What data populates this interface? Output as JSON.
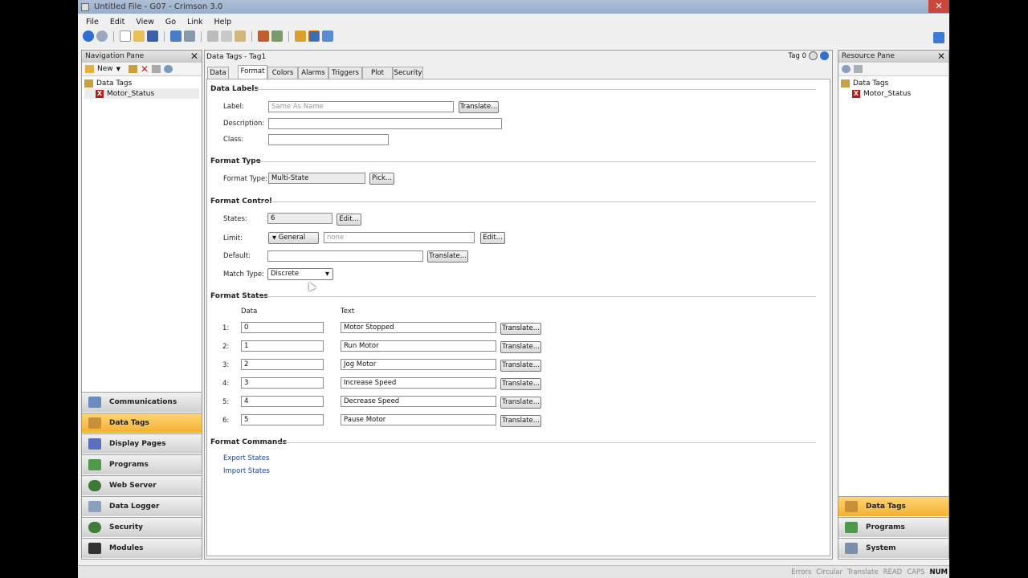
{
  "window": {
    "title": "Untitled File - G07 - Crimson 3.0"
  },
  "menu": [
    "File",
    "Edit",
    "View",
    "Go",
    "Link",
    "Help"
  ],
  "nav_pane": {
    "title": "Navigation Pane",
    "new_label": "New",
    "tree": [
      {
        "label": "Data Tags"
      },
      {
        "label": "Motor_Status"
      }
    ],
    "buttons": [
      {
        "label": "Communications"
      },
      {
        "label": "Data Tags"
      },
      {
        "label": "Display Pages"
      },
      {
        "label": "Programs"
      },
      {
        "label": "Web Server"
      },
      {
        "label": "Data Logger"
      },
      {
        "label": "Security"
      },
      {
        "label": "Modules"
      }
    ]
  },
  "main": {
    "header": "Data Tags - Tag1",
    "tag_indicator": "Tag 0",
    "tabs": [
      "Data",
      "Format",
      "Colors",
      "Alarms",
      "Triggers",
      "Plot",
      "Security"
    ],
    "data_labels": {
      "title": "Data Labels",
      "label": "Label:",
      "label_placeholder": "Same As Name",
      "translate": "Translate...",
      "description": "Description:",
      "class": "Class:"
    },
    "format_type": {
      "title": "Format Type",
      "label": "Format Type:",
      "value": "Multi-State",
      "pick": "Pick..."
    },
    "format_control": {
      "title": "Format Control",
      "states_label": "States:",
      "states_value": "6",
      "edit": "Edit...",
      "limit_label": "Limit:",
      "limit_mode": "General",
      "limit_value": "none",
      "default_label": "Default:",
      "translate": "Translate...",
      "match_label": "Match Type:",
      "match_value": "Discrete"
    },
    "format_states": {
      "title": "Format States",
      "col_data": "Data",
      "col_text": "Text",
      "translate": "Translate...",
      "rows": [
        {
          "index": "1:",
          "data": "0",
          "text": "Motor Stopped"
        },
        {
          "index": "2:",
          "data": "1",
          "text": "Run Motor"
        },
        {
          "index": "3:",
          "data": "2",
          "text": "Jog Motor"
        },
        {
          "index": "4:",
          "data": "3",
          "text": "Increase Speed"
        },
        {
          "index": "5:",
          "data": "4",
          "text": "Decrease Speed"
        },
        {
          "index": "6:",
          "data": "5",
          "text": "Pause Motor"
        }
      ]
    },
    "format_commands": {
      "title": "Format Commands",
      "export": "Export States",
      "import": "Import States"
    }
  },
  "resource_pane": {
    "title": "Resource Pane",
    "tree": [
      {
        "label": "Data Tags"
      },
      {
        "label": "Motor_Status"
      }
    ],
    "buttons": [
      {
        "label": "Data Tags"
      },
      {
        "label": "Programs"
      },
      {
        "label": "System"
      }
    ]
  },
  "statusbar": [
    "Errors",
    "Circular",
    "Translate",
    "READ",
    "CAPS",
    "NUM"
  ],
  "colors": {
    "accent": "#f3b232",
    "link": "#1a3f9c"
  }
}
